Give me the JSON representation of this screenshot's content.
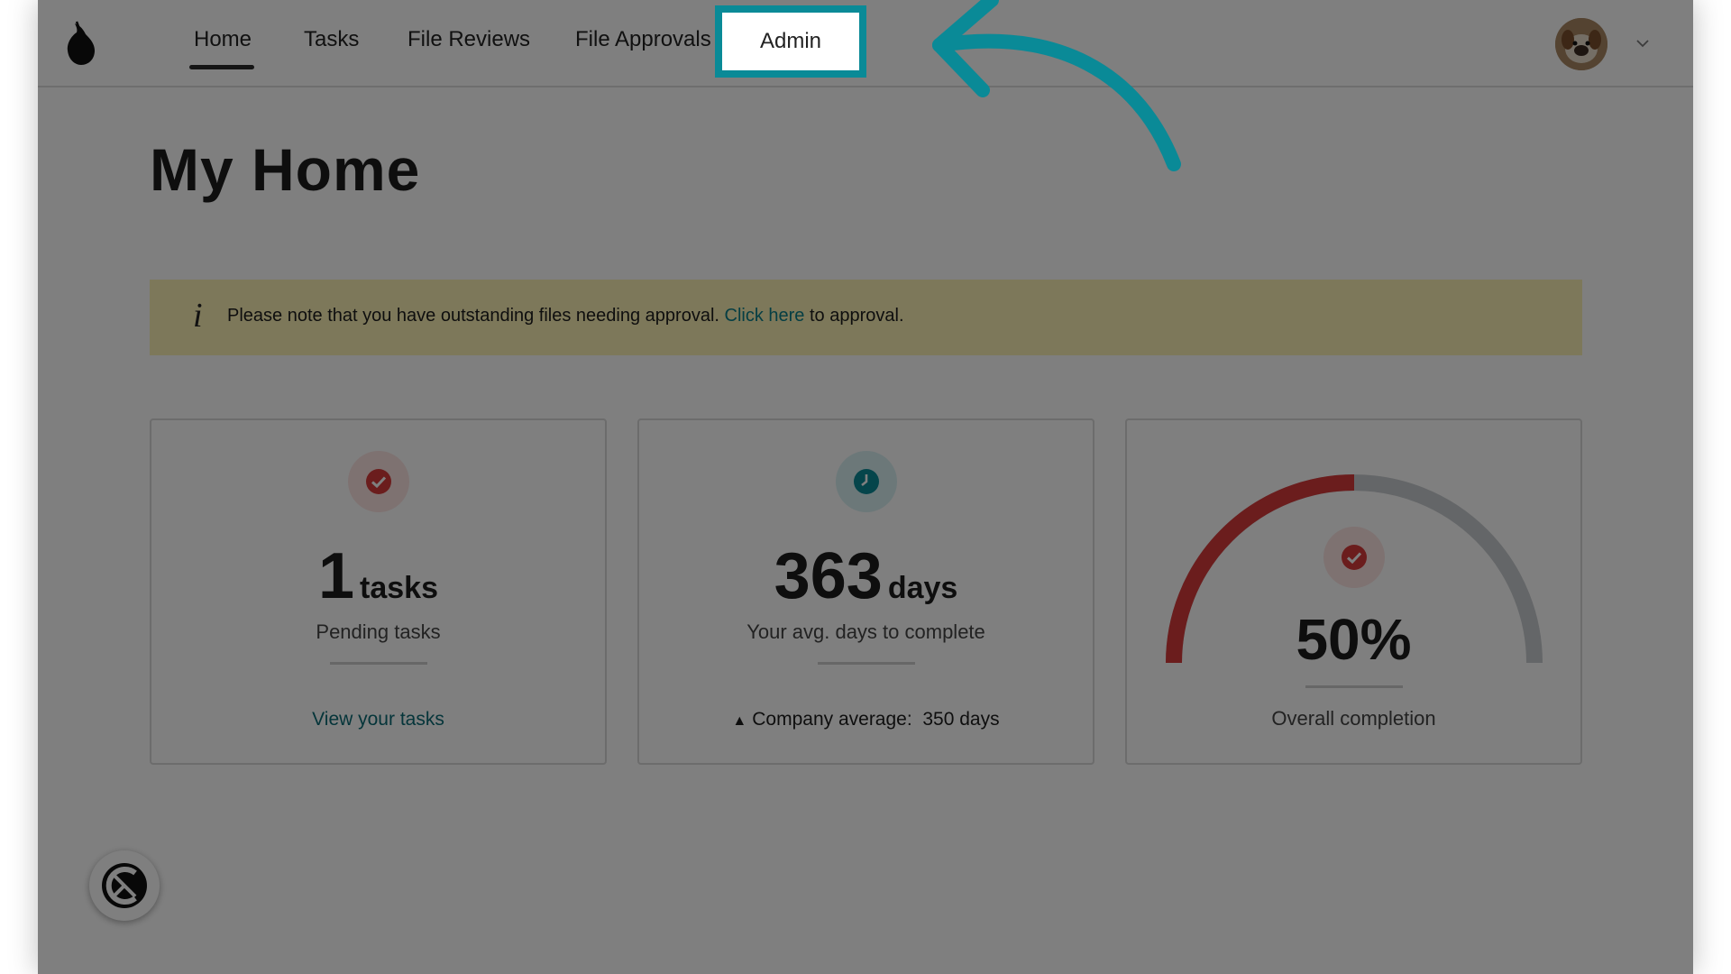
{
  "nav": {
    "items": [
      "Home",
      "Tasks",
      "File Reviews",
      "File Approvals"
    ],
    "admin_label": "Admin",
    "active": "Home"
  },
  "page": {
    "title": "My Home"
  },
  "notice": {
    "icon": "info-icon",
    "text_before": "Please note that you have outstanding files needing approval.",
    "link_text": "Click here",
    "text_after": "to approval."
  },
  "cards": {
    "tasks": {
      "number": "1",
      "unit": "tasks",
      "label": "Pending tasks",
      "link": "View your tasks",
      "icon": "check-circle-icon"
    },
    "days": {
      "number": "363",
      "unit": "days",
      "label": "Your avg. days to complete",
      "company_label": "Company average:",
      "company_value": "350 days",
      "icon": "clock-icon"
    },
    "completion": {
      "value": "50%",
      "fraction": 0.5,
      "label": "Overall completion",
      "icon": "check-circle-icon"
    }
  },
  "colors": {
    "accent_teal": "#0a8a97",
    "red": "#d63a3a",
    "notice_bg": "#fbf1b5",
    "gauge_track": "#c9cdd0"
  }
}
